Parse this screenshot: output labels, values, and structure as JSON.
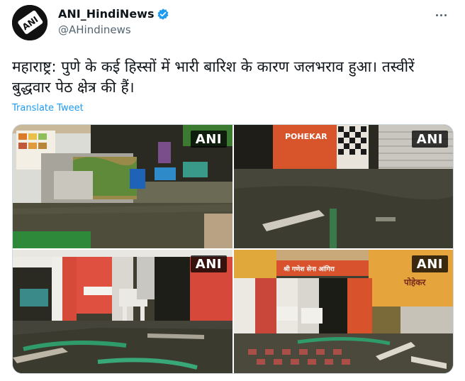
{
  "author": {
    "display_name": "ANI_HindiNews",
    "handle": "@AHindinews",
    "avatar_text": "ANI",
    "verified": true
  },
  "tweet": {
    "text": "महाराष्ट्र: पुणे के कई हिस्सों में भारी बारिश के कारण जलभराव हुआ। तस्वीरें बुद्धवार पेठ क्षेत्र की हैं।",
    "translate_label": "Translate Tweet"
  },
  "media": {
    "photos": [
      {
        "watermark": "ANI",
        "scene": "flooded-shop-with-cot"
      },
      {
        "watermark": "ANI",
        "scene": "flooded-shopfront-shutter"
      },
      {
        "watermark": "ANI",
        "scene": "flooded-store-interior"
      },
      {
        "watermark": "ANI",
        "scene": "flooded-storefronts-street"
      }
    ],
    "sign_texts": {
      "photo2_sign": "POHEKAR",
      "photo4_banner": "श्री गणेश सेना आंगिरा",
      "photo4_sign": "पोहेकर"
    }
  },
  "colors": {
    "link": "#1d9bf0",
    "verified": "#1d9bf0",
    "secondary_text": "#536471",
    "water": "#4a4a38"
  },
  "icons": {
    "verified": "verified-badge-icon",
    "more": "more-options-icon"
  }
}
